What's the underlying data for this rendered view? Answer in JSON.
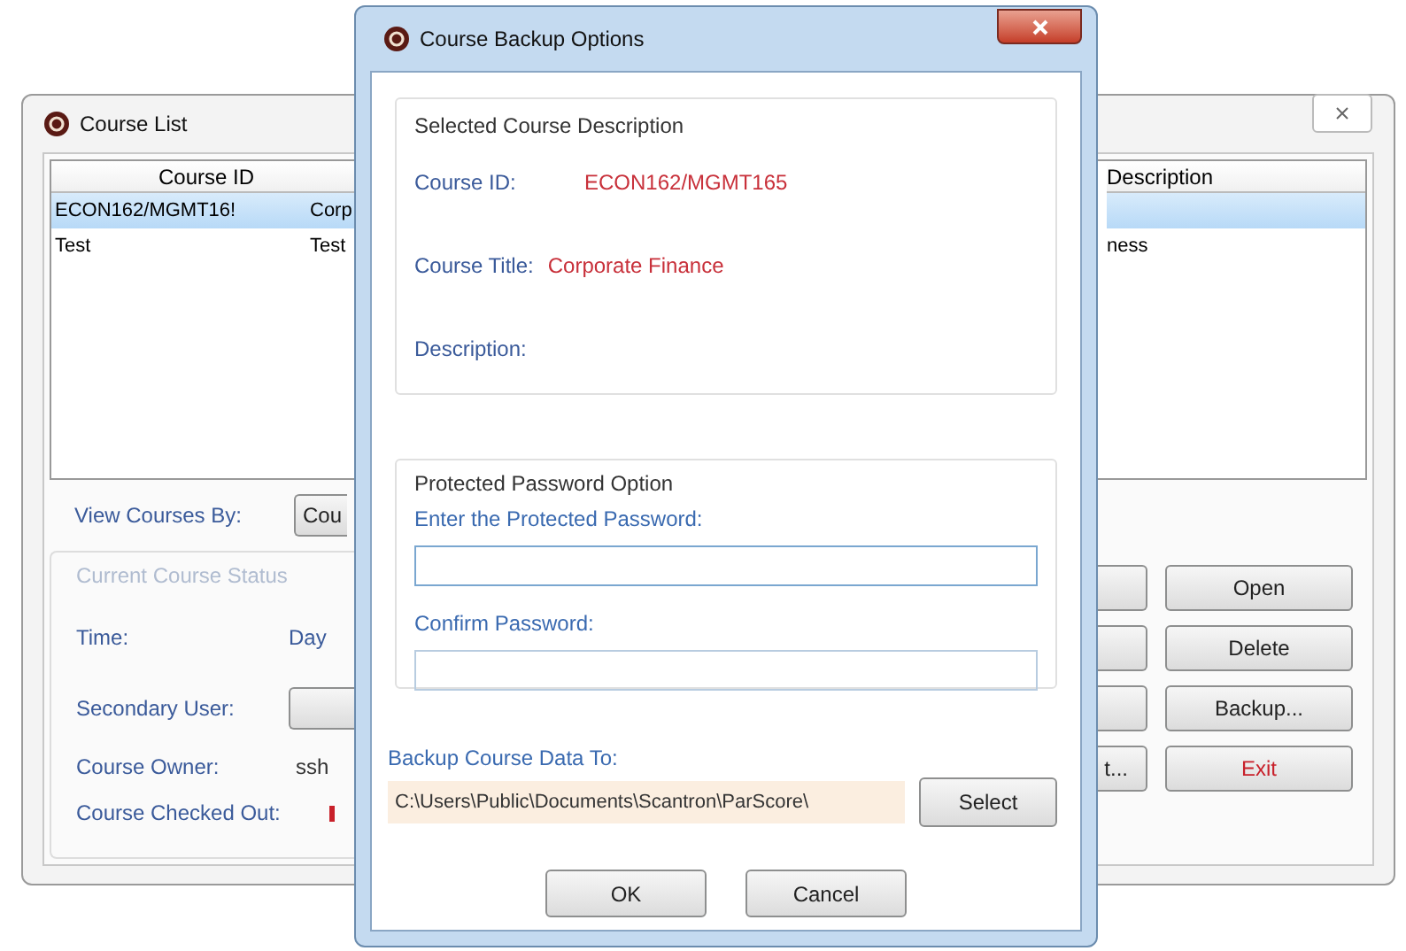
{
  "course_list": {
    "title": "Course List",
    "columns": [
      "Course ID"
    ],
    "header_fragment": "Description",
    "rows": [
      {
        "cells": [
          "ECON162/MGMT16!",
          "Corp",
          ""
        ],
        "selected": true
      },
      {
        "cells": [
          "Test",
          "Test",
          "ness"
        ],
        "selected": false
      }
    ],
    "view_by_label": "View Courses By:",
    "view_by_value": "Cou",
    "status_group": "Current Course Status",
    "time_label": "Time:",
    "time_value": "Day",
    "secondary_user_label": "Secondary User:",
    "owner_label": "Course Owner:",
    "owner_value": "ssh",
    "checked_out_label": "Course Checked Out:",
    "side_buttons": [
      {
        "kind": "blank"
      },
      {
        "kind": "blank"
      },
      {
        "kind": "blank"
      },
      {
        "kind": "labeled",
        "label": "t..."
      }
    ],
    "buttons": [
      {
        "label": "Open",
        "kind": "default"
      },
      {
        "label": "Delete",
        "kind": "normal"
      },
      {
        "label": "Backup...",
        "kind": "normal"
      },
      {
        "label": "Exit",
        "kind": "danger"
      }
    ]
  },
  "dialog": {
    "title": "Course Backup Options",
    "selected_group": "Selected Course Description",
    "fields": [
      {
        "label": "Course ID:",
        "value": "ECON162/MGMT165"
      },
      {
        "label": "Course Title:",
        "value": "Corporate Finance"
      },
      {
        "label": "Description:"
      }
    ],
    "password_group": "Protected Password Option",
    "password_label": "Enter the Protected Password:",
    "confirm_label": "Confirm Password:",
    "backup_label": "Backup Course Data To:",
    "backup_path": "C:\\Users\\Public\\Documents\\Scantron\\ParScore\\",
    "select_button": "Select",
    "ok_button": "OK",
    "cancel_button": "Cancel"
  }
}
